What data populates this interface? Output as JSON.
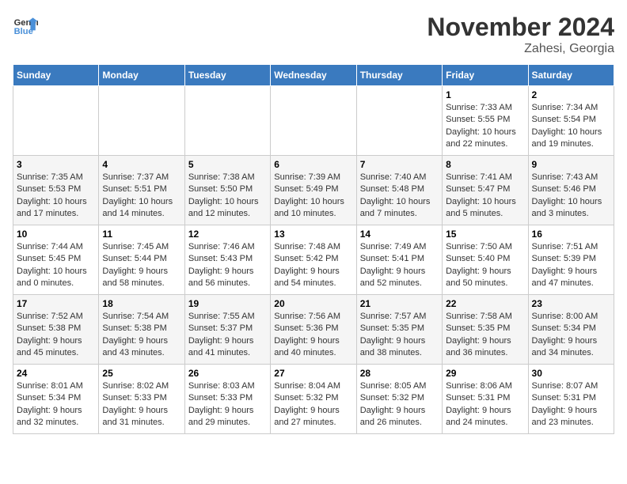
{
  "header": {
    "logo_general": "General",
    "logo_blue": "Blue",
    "month_title": "November 2024",
    "location": "Zahesi, Georgia"
  },
  "weekdays": [
    "Sunday",
    "Monday",
    "Tuesday",
    "Wednesday",
    "Thursday",
    "Friday",
    "Saturday"
  ],
  "weeks": [
    [
      {
        "day": "",
        "info": ""
      },
      {
        "day": "",
        "info": ""
      },
      {
        "day": "",
        "info": ""
      },
      {
        "day": "",
        "info": ""
      },
      {
        "day": "",
        "info": ""
      },
      {
        "day": "1",
        "info": "Sunrise: 7:33 AM\nSunset: 5:55 PM\nDaylight: 10 hours\nand 22 minutes."
      },
      {
        "day": "2",
        "info": "Sunrise: 7:34 AM\nSunset: 5:54 PM\nDaylight: 10 hours\nand 19 minutes."
      }
    ],
    [
      {
        "day": "3",
        "info": "Sunrise: 7:35 AM\nSunset: 5:53 PM\nDaylight: 10 hours\nand 17 minutes."
      },
      {
        "day": "4",
        "info": "Sunrise: 7:37 AM\nSunset: 5:51 PM\nDaylight: 10 hours\nand 14 minutes."
      },
      {
        "day": "5",
        "info": "Sunrise: 7:38 AM\nSunset: 5:50 PM\nDaylight: 10 hours\nand 12 minutes."
      },
      {
        "day": "6",
        "info": "Sunrise: 7:39 AM\nSunset: 5:49 PM\nDaylight: 10 hours\nand 10 minutes."
      },
      {
        "day": "7",
        "info": "Sunrise: 7:40 AM\nSunset: 5:48 PM\nDaylight: 10 hours\nand 7 minutes."
      },
      {
        "day": "8",
        "info": "Sunrise: 7:41 AM\nSunset: 5:47 PM\nDaylight: 10 hours\nand 5 minutes."
      },
      {
        "day": "9",
        "info": "Sunrise: 7:43 AM\nSunset: 5:46 PM\nDaylight: 10 hours\nand 3 minutes."
      }
    ],
    [
      {
        "day": "10",
        "info": "Sunrise: 7:44 AM\nSunset: 5:45 PM\nDaylight: 10 hours\nand 0 minutes."
      },
      {
        "day": "11",
        "info": "Sunrise: 7:45 AM\nSunset: 5:44 PM\nDaylight: 9 hours\nand 58 minutes."
      },
      {
        "day": "12",
        "info": "Sunrise: 7:46 AM\nSunset: 5:43 PM\nDaylight: 9 hours\nand 56 minutes."
      },
      {
        "day": "13",
        "info": "Sunrise: 7:48 AM\nSunset: 5:42 PM\nDaylight: 9 hours\nand 54 minutes."
      },
      {
        "day": "14",
        "info": "Sunrise: 7:49 AM\nSunset: 5:41 PM\nDaylight: 9 hours\nand 52 minutes."
      },
      {
        "day": "15",
        "info": "Sunrise: 7:50 AM\nSunset: 5:40 PM\nDaylight: 9 hours\nand 50 minutes."
      },
      {
        "day": "16",
        "info": "Sunrise: 7:51 AM\nSunset: 5:39 PM\nDaylight: 9 hours\nand 47 minutes."
      }
    ],
    [
      {
        "day": "17",
        "info": "Sunrise: 7:52 AM\nSunset: 5:38 PM\nDaylight: 9 hours\nand 45 minutes."
      },
      {
        "day": "18",
        "info": "Sunrise: 7:54 AM\nSunset: 5:38 PM\nDaylight: 9 hours\nand 43 minutes."
      },
      {
        "day": "19",
        "info": "Sunrise: 7:55 AM\nSunset: 5:37 PM\nDaylight: 9 hours\nand 41 minutes."
      },
      {
        "day": "20",
        "info": "Sunrise: 7:56 AM\nSunset: 5:36 PM\nDaylight: 9 hours\nand 40 minutes."
      },
      {
        "day": "21",
        "info": "Sunrise: 7:57 AM\nSunset: 5:35 PM\nDaylight: 9 hours\nand 38 minutes."
      },
      {
        "day": "22",
        "info": "Sunrise: 7:58 AM\nSunset: 5:35 PM\nDaylight: 9 hours\nand 36 minutes."
      },
      {
        "day": "23",
        "info": "Sunrise: 8:00 AM\nSunset: 5:34 PM\nDaylight: 9 hours\nand 34 minutes."
      }
    ],
    [
      {
        "day": "24",
        "info": "Sunrise: 8:01 AM\nSunset: 5:34 PM\nDaylight: 9 hours\nand 32 minutes."
      },
      {
        "day": "25",
        "info": "Sunrise: 8:02 AM\nSunset: 5:33 PM\nDaylight: 9 hours\nand 31 minutes."
      },
      {
        "day": "26",
        "info": "Sunrise: 8:03 AM\nSunset: 5:33 PM\nDaylight: 9 hours\nand 29 minutes."
      },
      {
        "day": "27",
        "info": "Sunrise: 8:04 AM\nSunset: 5:32 PM\nDaylight: 9 hours\nand 27 minutes."
      },
      {
        "day": "28",
        "info": "Sunrise: 8:05 AM\nSunset: 5:32 PM\nDaylight: 9 hours\nand 26 minutes."
      },
      {
        "day": "29",
        "info": "Sunrise: 8:06 AM\nSunset: 5:31 PM\nDaylight: 9 hours\nand 24 minutes."
      },
      {
        "day": "30",
        "info": "Sunrise: 8:07 AM\nSunset: 5:31 PM\nDaylight: 9 hours\nand 23 minutes."
      }
    ]
  ]
}
